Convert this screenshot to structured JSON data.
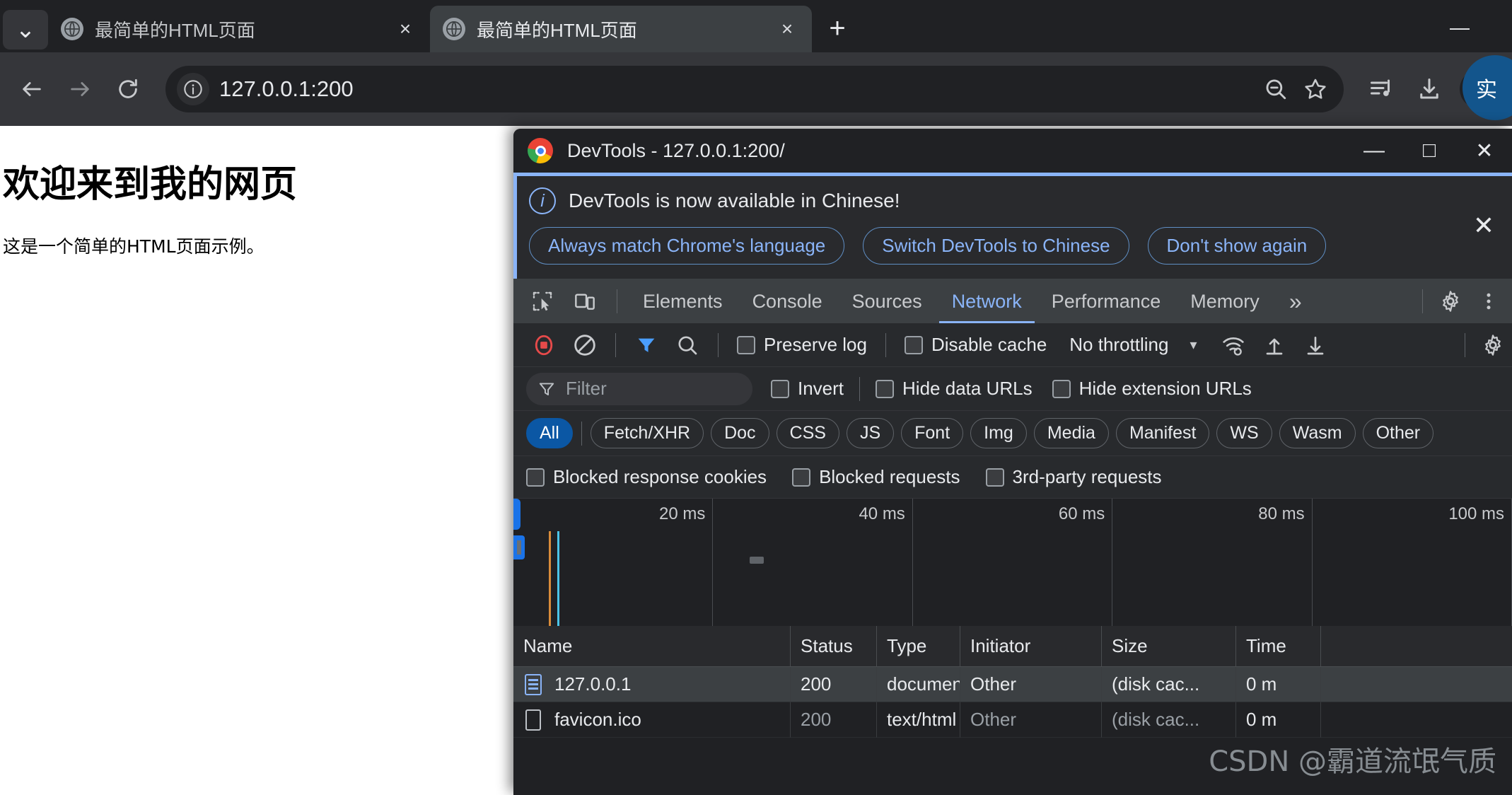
{
  "browser": {
    "tabs": [
      {
        "title": "最简单的HTML页面",
        "active": false,
        "favicon": "globe-icon",
        "close": "×"
      },
      {
        "title": "最简单的HTML页面",
        "active": true,
        "favicon": "globe-icon",
        "close": "×"
      }
    ],
    "tab_search_label": "⌄",
    "new_tab_label": "+",
    "minimize_label": "—",
    "nav": {
      "back": "←",
      "forward": "→",
      "reload": "⟳"
    },
    "omnibox": {
      "info_icon": "info-circle-icon",
      "url": "127.0.0.1:200",
      "zoom_out_icon": "zoom-out-icon",
      "bookmark_icon": "star-icon"
    },
    "toolbar_icons": [
      "media-playlist-icon",
      "download-icon",
      "profile-avatar-icon"
    ],
    "badge_text": "实"
  },
  "page": {
    "heading": "欢迎来到我的网页",
    "paragraph": "这是一个简单的HTML页面示例。"
  },
  "devtools": {
    "title": "DevTools - 127.0.0.1:200/",
    "window_controls": {
      "minimize": "—",
      "maximize": "□",
      "close": "✕"
    },
    "banner": {
      "icon": "info-icon",
      "message": "DevTools is now available in Chinese!",
      "buttons": [
        "Always match Chrome's language",
        "Switch DevTools to Chinese",
        "Don't show again"
      ],
      "close": "✕"
    },
    "tabbar": {
      "inspect_icon": "inspect-element-icon",
      "device_icon": "device-toolbar-icon",
      "tabs": [
        {
          "label": "Elements",
          "active": false
        },
        {
          "label": "Console",
          "active": false
        },
        {
          "label": "Sources",
          "active": false
        },
        {
          "label": "Network",
          "active": true
        },
        {
          "label": "Performance",
          "active": false
        },
        {
          "label": "Memory",
          "active": false
        }
      ],
      "overflow": "»",
      "settings_icon": "gear-icon",
      "more_icon": "more-vertical-icon"
    },
    "network_toolbar": {
      "record_icon": "record-stop-icon",
      "clear_icon": "clear-icon",
      "filter_icon": "filter-icon",
      "search_icon": "search-icon",
      "preserve_log": {
        "label": "Preserve log",
        "checked": false
      },
      "disable_cache": {
        "label": "Disable cache",
        "checked": false
      },
      "throttling": "No throttling",
      "throttling_caret": "▾",
      "wifi_icon": "network-conditions-icon",
      "import_icon": "import-har-icon",
      "export_icon": "export-har-icon",
      "settings_icon": "network-settings-gear-icon"
    },
    "filter_bar": {
      "filter_icon": "filter-funnel-icon",
      "filter_placeholder": "Filter",
      "filter_value": "",
      "invert": {
        "label": "Invert",
        "checked": false
      },
      "hide_data_urls": {
        "label": "Hide data URLs",
        "checked": false
      },
      "hide_extension_urls": {
        "label": "Hide extension URLs",
        "checked": false
      }
    },
    "type_chips": [
      {
        "label": "All",
        "active": true
      },
      {
        "label": "Fetch/XHR",
        "active": false
      },
      {
        "label": "Doc",
        "active": false
      },
      {
        "label": "CSS",
        "active": false
      },
      {
        "label": "JS",
        "active": false
      },
      {
        "label": "Font",
        "active": false
      },
      {
        "label": "Img",
        "active": false
      },
      {
        "label": "Media",
        "active": false
      },
      {
        "label": "Manifest",
        "active": false
      },
      {
        "label": "WS",
        "active": false
      },
      {
        "label": "Wasm",
        "active": false
      },
      {
        "label": "Other",
        "active": false
      }
    ],
    "block_checks": [
      {
        "label": "Blocked response cookies",
        "checked": false
      },
      {
        "label": "Blocked requests",
        "checked": false
      },
      {
        "label": "3rd-party requests",
        "checked": false
      }
    ],
    "overview": {
      "ticks": [
        "20 ms",
        "40 ms",
        "60 ms",
        "80 ms",
        "100 ms"
      ],
      "dom_content_loaded_color": "#0b6cd6",
      "load_event_color": "#d98c3a",
      "marker_cyan": "#4bc4e8"
    },
    "table": {
      "columns": [
        "Name",
        "Status",
        "Type",
        "Initiator",
        "Size",
        "Time"
      ],
      "rows": [
        {
          "icon": "document-icon",
          "name": "127.0.0.1",
          "status": "200",
          "type": "document",
          "initiator": "Other",
          "size": "(disk cac...",
          "time": "0 m",
          "selected": true
        },
        {
          "icon": "generic-file-icon",
          "name": "favicon.ico",
          "status": "200",
          "type": "text/html",
          "initiator": "Other",
          "size": "(disk cac...",
          "time": "0 m",
          "selected": false
        }
      ]
    }
  },
  "watermark": "CSDN @霸道流氓气质"
}
